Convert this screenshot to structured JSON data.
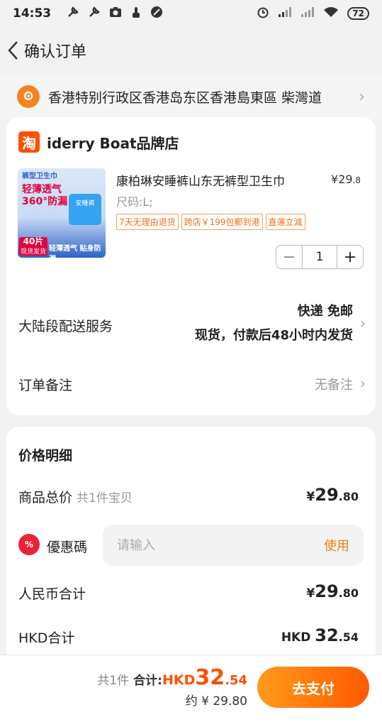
{
  "status": {
    "time": "14:53",
    "battery": "72"
  },
  "nav": {
    "title": "确认订单"
  },
  "address": {
    "text": "香港特别行政区香港岛东区香港島東區 柴灣道"
  },
  "shop": {
    "icon_text": "淘",
    "name": "iderry Boat品牌店",
    "product": {
      "image_text": {
        "top": "裤型卫生巾",
        "main_line1": "轻薄透气",
        "main_line2": "360°防漏",
        "pack": "安睡裤",
        "badge_line1": "40片",
        "badge_line2": "现货发货",
        "bottom": "轻薄透气 贴身防漏"
      },
      "title": "康柏琳安睡裤山东无裤型卫生巾",
      "price_symbol": "¥",
      "price_int": "29",
      "price_dec": ".8",
      "spec": "尺码:L;",
      "tags": [
        "7天无理由退货",
        "跨店￥199包郵到港",
        "直運立減"
      ],
      "quantity": "1"
    },
    "shipping": {
      "label": "大陆段配送服务",
      "line1": "快递 免邮",
      "line2": "现货，付款后48小时内发货"
    },
    "note": {
      "label": "订单备注",
      "value": "无备注"
    }
  },
  "price": {
    "title": "价格明细",
    "goods_total": {
      "label": "商品总价",
      "sub": "共1件宝贝",
      "cur": "¥",
      "int": "29",
      "dec": ".80"
    },
    "coupon": {
      "icon_text": "%",
      "label": "優惠碼",
      "placeholder": "请输入",
      "action": "使用"
    },
    "rmb_total": {
      "label": "人民币合计",
      "cur": "¥",
      "int": "29",
      "dec": ".80"
    },
    "hkd_total": {
      "label": "HKD合计",
      "cur": "HKD ",
      "int": "32",
      "dec": ".54"
    }
  },
  "footer": {
    "count": "共1件",
    "label": "合计:",
    "cur": "HKD",
    "int": "32",
    "dec": ".54",
    "approx": "约 ¥ 29.80",
    "pay_button": "去支付"
  },
  "colors": {
    "accent": "#ff5000",
    "tag": "#f16f1a",
    "coupon": "#e9233a"
  }
}
